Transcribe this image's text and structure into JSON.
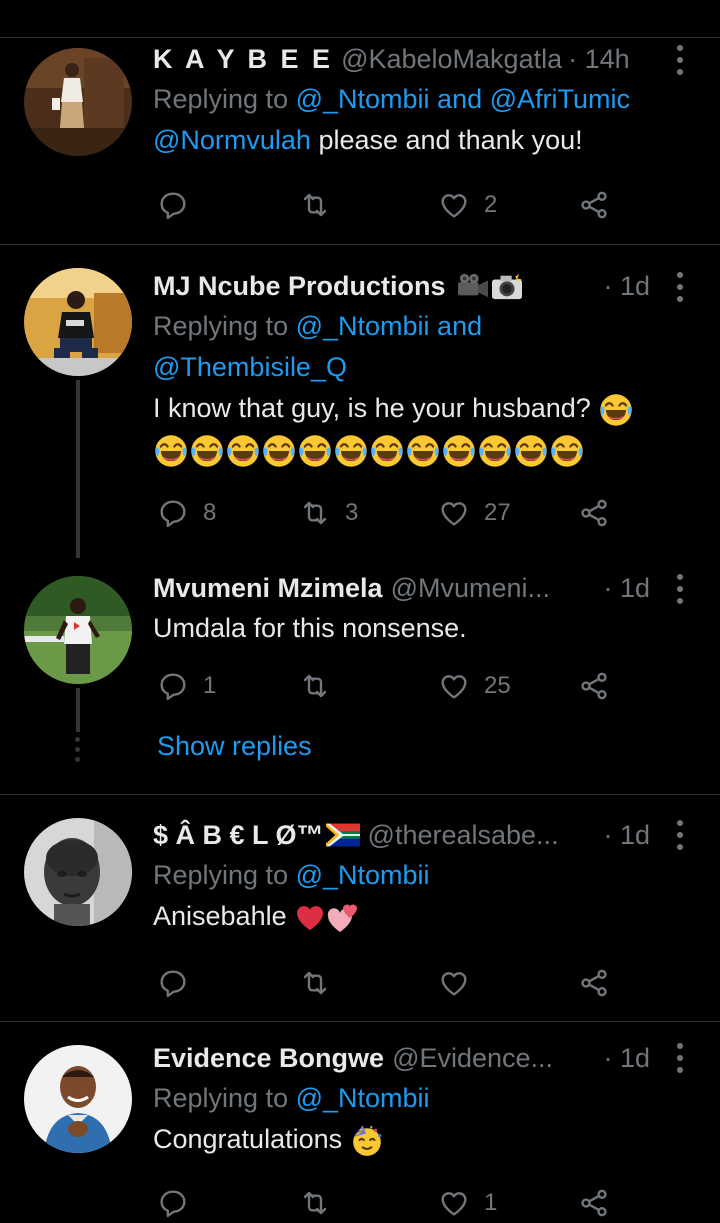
{
  "tweets": [
    {
      "name": "K A Y B E E",
      "handle": "@KabeloMakgatla",
      "time": "· 14h",
      "replying_label": "Replying to ",
      "replying_to_1": "@_Ntombii",
      "replying_and": " and ",
      "replying_to_2": "@AfriTumic",
      "mention": "@Normvulah",
      "text": " please and thank you!",
      "reply_count": "",
      "retweet_count": "",
      "like_count": "2"
    },
    {
      "name": "MJ Ncube Productions",
      "time": "· 1d",
      "replying_label": "Replying to ",
      "replying_to_1": "@_Ntombii",
      "replying_and": " and",
      "replying_to_2": "@Thembisile_Q",
      "text": "I know that guy, is he your husband?",
      "reply_count": "8",
      "retweet_count": "3",
      "like_count": "27"
    },
    {
      "name": "Mvumeni Mzimela",
      "handle": "@Mvumeni...",
      "time": "· 1d",
      "text": "Umdala for this nonsense.",
      "reply_count": "1",
      "retweet_count": "",
      "like_count": "25",
      "show_replies": "Show replies"
    },
    {
      "name": "$ Â B € L Ø™",
      "handle": "@therealsabe...",
      "time": "· 1d",
      "replying_label": "Replying to ",
      "replying_to_1": "@_Ntombii",
      "text": "Anisebahle",
      "reply_count": "",
      "retweet_count": "",
      "like_count": ""
    },
    {
      "name": "Evidence Bongwe",
      "handle": "@Evidence...",
      "time": "· 1d",
      "replying_label": "Replying to ",
      "replying_to_1": "@_Ntombii",
      "text": "Congratulations",
      "reply_count": "",
      "retweet_count": "",
      "like_count": "1"
    }
  ],
  "icons": {
    "reply": "reply-icon",
    "retweet": "retweet-icon",
    "like": "heart-icon",
    "share": "share-icon",
    "more": "more-icon"
  },
  "colors": {
    "background": "#000000",
    "text": "#e7e9ea",
    "secondary": "#71767b",
    "link": "#1d9bf0",
    "divider": "#2f3336"
  }
}
